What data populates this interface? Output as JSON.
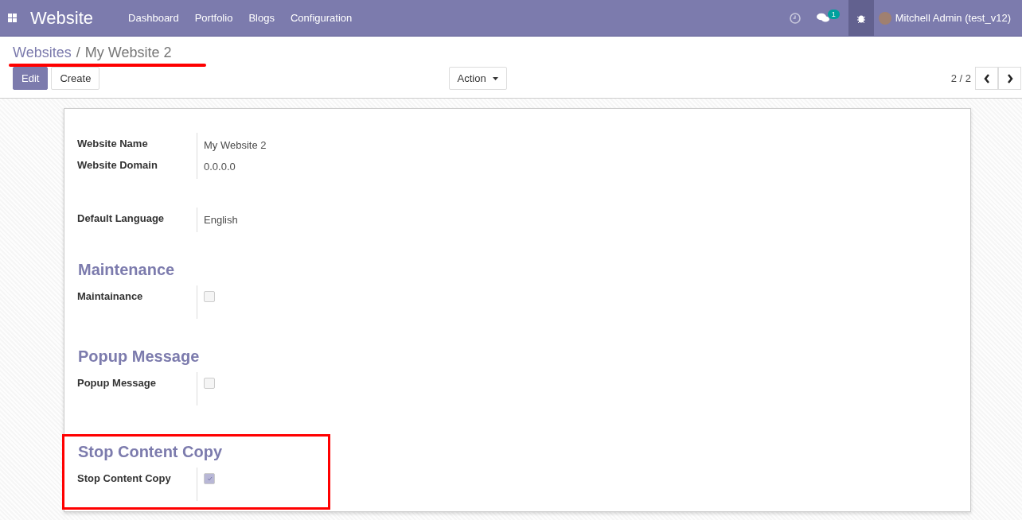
{
  "navbar": {
    "brand": "Website",
    "menu": [
      "Dashboard",
      "Portfolio",
      "Blogs",
      "Configuration"
    ],
    "messages_count": "1",
    "debug_active": true,
    "user": "Mitchell Admin (test_v12)"
  },
  "breadcrumb": {
    "separator": "/",
    "items": [
      {
        "label": "Websites",
        "link": true
      },
      {
        "label": "My Website 2",
        "link": false
      }
    ],
    "underlined": true
  },
  "buttons": [
    {
      "label": "Edit",
      "primary": true
    },
    {
      "label": "Create",
      "primary": false
    }
  ],
  "action": {
    "label": "Action"
  },
  "pager": {
    "value": "2 / 2"
  },
  "sheet": {
    "sections": [
      {
        "fields": [
          {
            "kind": "text",
            "label": "Website Name",
            "value": "My Website 2"
          },
          {
            "kind": "text",
            "label": "Website Domain",
            "value": "0.0.0.0"
          }
        ],
        "highlighted": false
      },
      {
        "fields": [
          {
            "kind": "text",
            "label": "Default Language",
            "value": "English"
          }
        ],
        "highlighted": false
      },
      {
        "title": "Maintenance",
        "fields": [
          {
            "kind": "checkbox",
            "label": "Maintainance",
            "checked": false
          }
        ],
        "highlighted": false
      },
      {
        "title": "Popup Message",
        "fields": [
          {
            "kind": "checkbox",
            "label": "Popup Message",
            "checked": false
          }
        ],
        "highlighted": false
      },
      {
        "title": "Stop Content Copy",
        "fields": [
          {
            "kind": "checkbox",
            "label": "Stop Content Copy",
            "checked": true
          }
        ],
        "highlighted": true
      }
    ]
  }
}
